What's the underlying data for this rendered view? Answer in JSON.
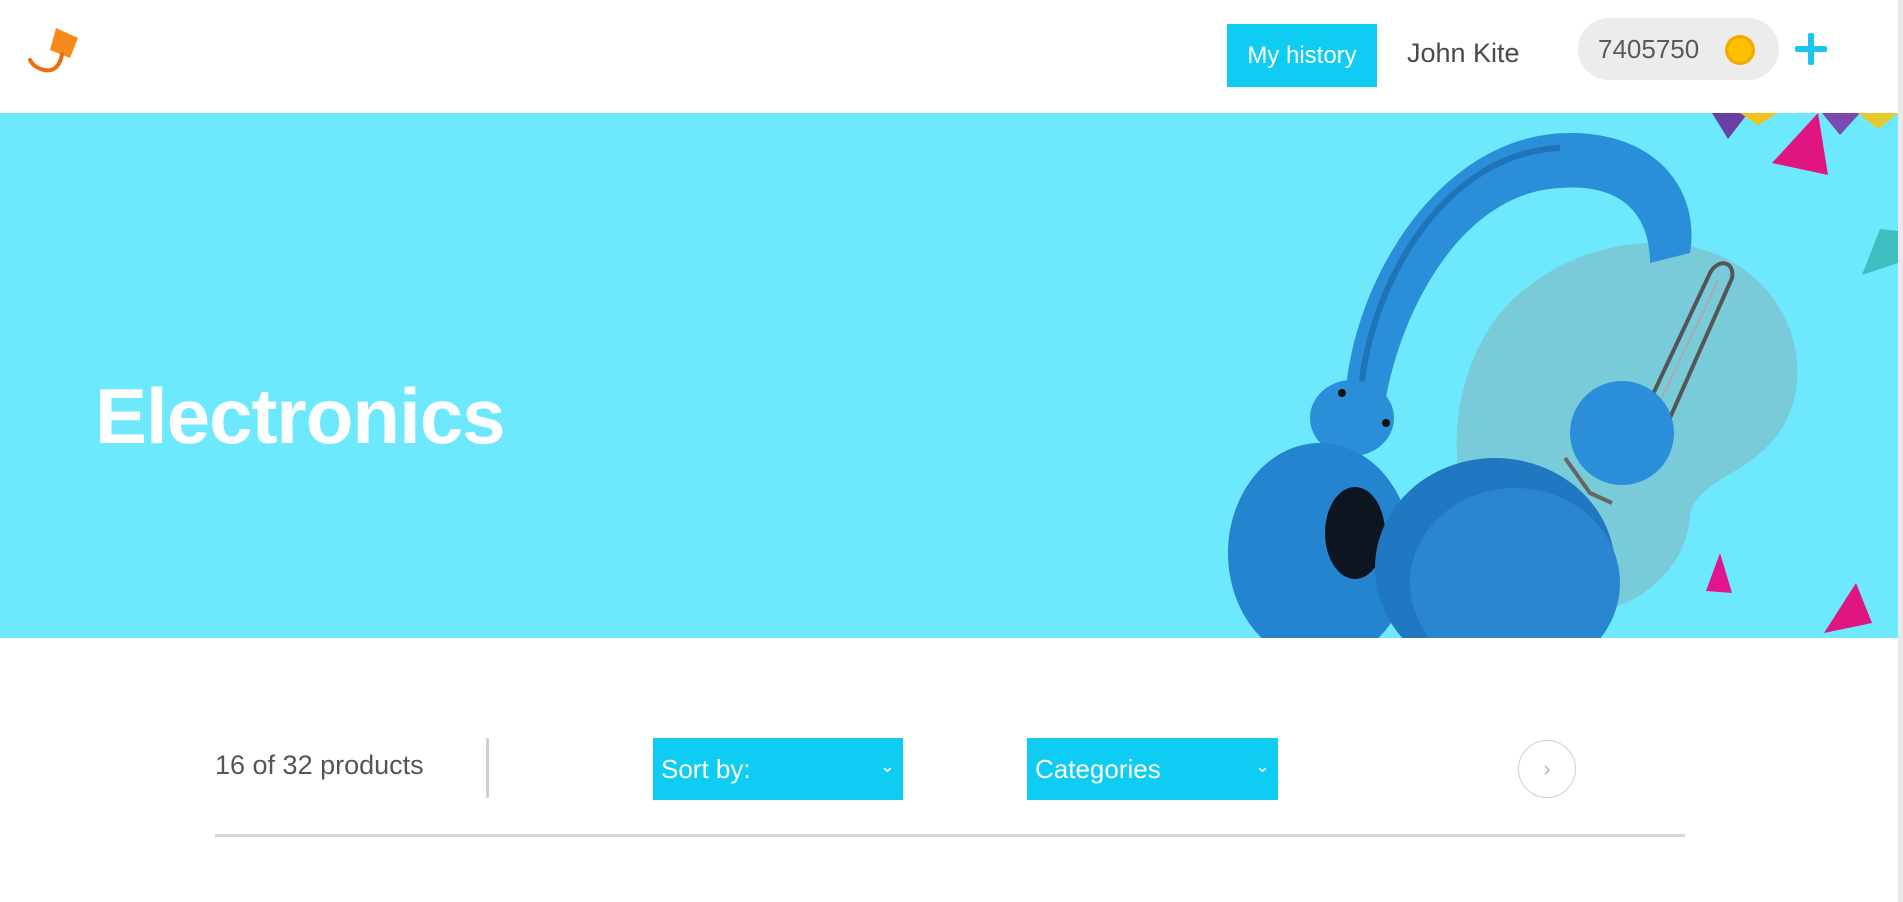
{
  "header": {
    "logo_icon": "paint-brush-logo",
    "history_button": "My history",
    "user_name": "John Kite",
    "balance": "7405750",
    "coin_icon": "coin-icon",
    "add_icon": "plus-icon"
  },
  "banner": {
    "title": "Electronics",
    "background_color": "#6ee8fd",
    "image_icon": "headphones-illustration"
  },
  "toolbar": {
    "product_count": "16 of 32 products",
    "sort_label": "Sort by:",
    "categories_label": "Categories",
    "next_icon": "chevron-right-icon",
    "accent_color": "#0fcdf2"
  }
}
